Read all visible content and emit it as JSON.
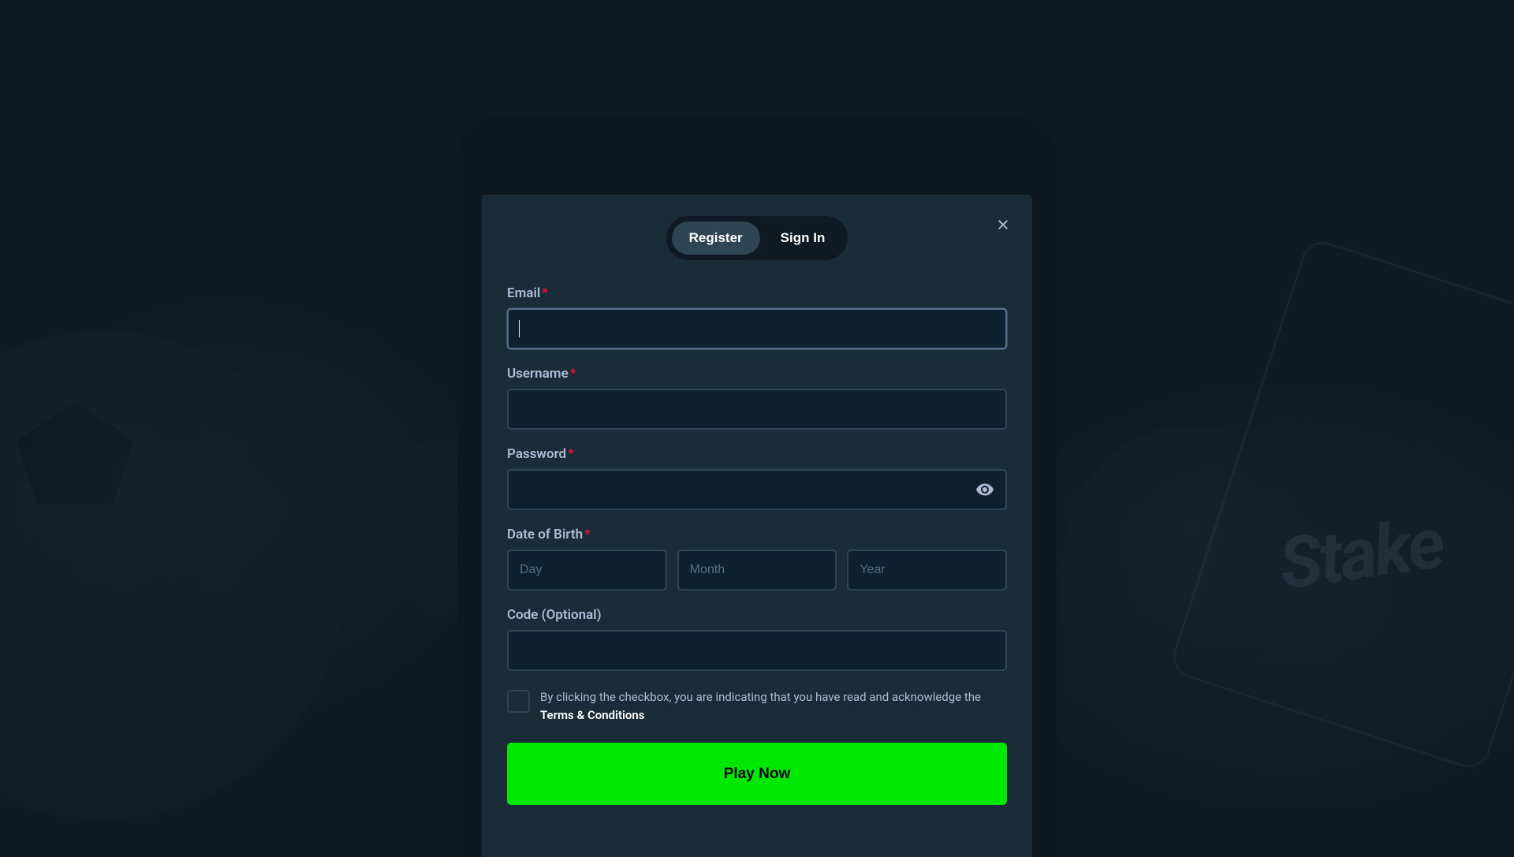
{
  "tabs": {
    "register": "Register",
    "signin": "Sign In"
  },
  "fields": {
    "email": {
      "label": "Email",
      "required": true
    },
    "username": {
      "label": "Username",
      "required": true
    },
    "password": {
      "label": "Password",
      "required": true
    },
    "dob": {
      "label": "Date of Birth",
      "required": true,
      "day_placeholder": "Day",
      "month_placeholder": "Month",
      "year_placeholder": "Year"
    },
    "code": {
      "label": "Code (Optional)",
      "required": false
    }
  },
  "agreement": {
    "text_prefix": "By clicking the checkbox, you are indicating that you have read and acknowledge the ",
    "terms_label": "Terms & Conditions"
  },
  "submit_label": "Play Now",
  "colors": {
    "accent": "#00e701",
    "required": "#e9113c",
    "bg_modal": "#1a2c38",
    "bg_input": "#0f212e"
  }
}
